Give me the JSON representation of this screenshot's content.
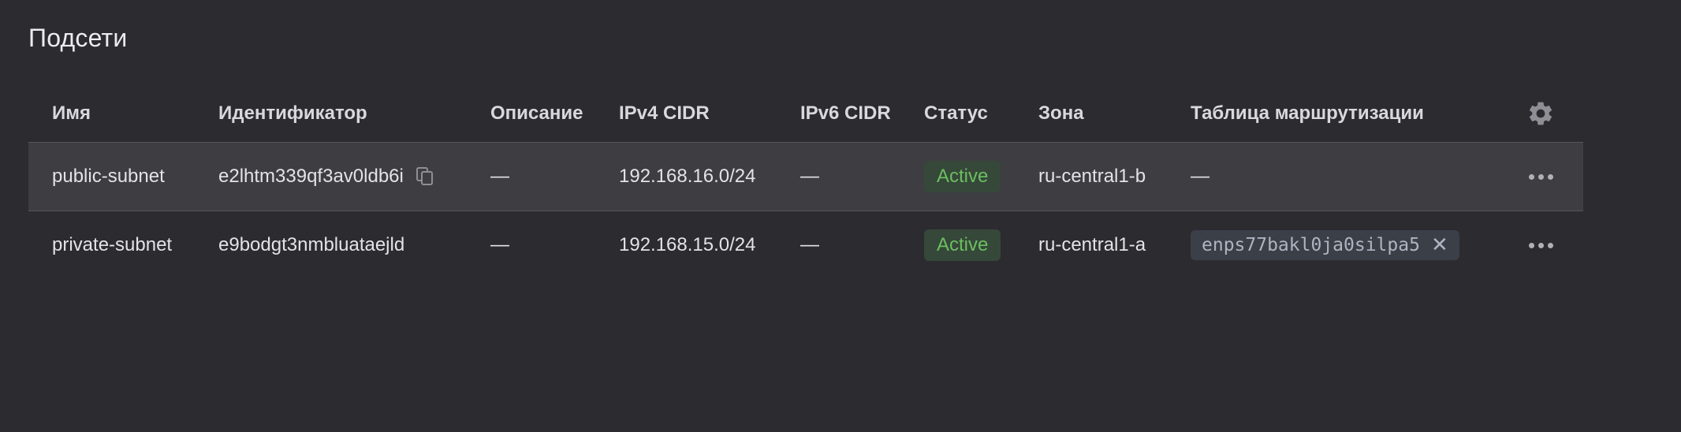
{
  "page": {
    "title": "Подсети"
  },
  "table": {
    "columns": {
      "name": "Имя",
      "id": "Идентификатор",
      "description": "Описание",
      "ipv4": "IPv4 CIDR",
      "ipv6": "IPv6 CIDR",
      "status": "Статус",
      "zone": "Зона",
      "route_table": "Таблица маршрутизации"
    },
    "settings_icon": "gear-icon",
    "rows": [
      {
        "name": "public-subnet",
        "id": "e2lhtm339qf3av0ldb6i",
        "description": "—",
        "ipv4": "192.168.16.0/24",
        "ipv6": "—",
        "status": "Active",
        "zone": "ru-central1-b",
        "route_table": "—"
      },
      {
        "name": "private-subnet",
        "id": "e9bodgt3nmbluataejld",
        "description": "—",
        "ipv4": "192.168.15.0/24",
        "ipv6": "—",
        "status": "Active",
        "zone": "ru-central1-a",
        "route_table": "enps77bakl0ja0silpa5"
      }
    ]
  },
  "colors": {
    "background": "#2c2b30",
    "row_hover": "#3e3d42",
    "status_active_text": "#6bbf5f",
    "status_active_bg": "#36483a",
    "chip_bg": "#3b3f48"
  }
}
